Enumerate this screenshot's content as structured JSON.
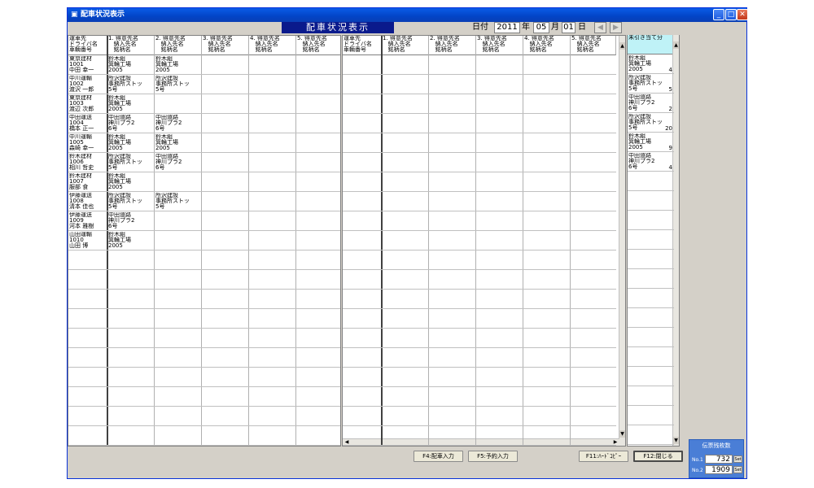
{
  "window": {
    "title": "配車状況表示",
    "title_icon": "app-icon",
    "buttons": [
      "minimize-icon",
      "maximize-icon",
      "close-icon"
    ]
  },
  "header": {
    "title": "配車状況表示",
    "date_label": "日付",
    "year": "2011",
    "year_unit": "年",
    "month": "05",
    "month_unit": "月",
    "day": "01",
    "day_unit": "日",
    "prev_glyph": "◀",
    "next_glyph": "▶"
  },
  "columns": [
    "運車先\nドライバ名\n車輌番号",
    "1. 得意先名\n   納入先名\n   銘柄名",
    "2. 得意先名\n   納入先名\n   銘柄名",
    "3. 得意先名\n   納入先名\n   銘柄名",
    "4. 得意先名\n   納入先名\n   銘柄名",
    "5. 得意先名\n   納入先名\n   銘柄名"
  ],
  "rows": [
    {
      "vehicle": "東京建材\n1001\n中田 幸一",
      "slots": [
        "鈴木組\n箕輪工場\n2005",
        "鈴木組\n箕輪工場\n2005"
      ]
    },
    {
      "vehicle": "中川運輸\n1002\n渡沢 一郎",
      "slots": [
        "所沢建設\n事務所ストッ\n5号",
        "所沢建設\n事務所ストッ\n5号"
      ]
    },
    {
      "vehicle": "東京建材\n1003\n渡辺 次郎",
      "slots": [
        "鈴木組\n箕輪工場\n2005"
      ]
    },
    {
      "vehicle": "中田運送\n1004\n橋本 正一",
      "slots": [
        "中田道路\n神川プラ2\n6号",
        "中田道路\n神川プラ2\n6号"
      ]
    },
    {
      "vehicle": "中川運輸\n1005\n森崎 幸一",
      "slots": [
        "鈴木組\n箕輪工場\n2005",
        "鈴木組\n箕輪工場\n2005"
      ]
    },
    {
      "vehicle": "鈴木建材\n1006\n相川 哲史",
      "slots": [
        "所沢建設\n事務所ストッ\n5号",
        "中田道路\n神川プラ2\n6号"
      ]
    },
    {
      "vehicle": "鈴木建材\n1007\n服部 食",
      "slots": [
        "鈴木組\n箕輪工場\n2005"
      ]
    },
    {
      "vehicle": "伊藤運送\n1008\n清本 佳也",
      "slots": [
        "所沢建設\n事務所ストッ\n5号",
        "所沢建設\n事務所ストッ\n5号"
      ]
    },
    {
      "vehicle": "伊藤運送\n1009\n河本 雅樹",
      "slots": [
        "中田道路\n神川プラ2\n6号"
      ]
    },
    {
      "vehicle": "山田運輸\n1010\n山田 博",
      "slots": [
        "鈴木組\n箕輪工場\n2005"
      ]
    }
  ],
  "unassigned": {
    "header": "未引き当て分",
    "items": [
      {
        "text": "鈴木組\n箕輪工場\n2005",
        "count": "4"
      },
      {
        "text": "所沢建設\n事務所ストッ\n5号",
        "count": "5"
      },
      {
        "text": "中田道路\n神川プラ2\n6号",
        "count": "2"
      },
      {
        "text": "所沢建設\n事務所ストッ\n5号",
        "count": "20"
      },
      {
        "text": "鈴木組\n箕輪工場\n2005",
        "count": "9"
      },
      {
        "text": "中田道路\n神川プラ2\n6号",
        "count": "4"
      }
    ]
  },
  "footer": {
    "f4": "F4:配車入力",
    "f5": "F5:予約入力",
    "f11": "F11:ﾊｰﾄﾞｺﾋﾟｰ",
    "f12": "F12:閉じる"
  },
  "slip": {
    "title": "伝票残枚数",
    "no1_label": "No.1",
    "no1_value": "732",
    "no2_label": "No.2",
    "no2_value": "1909",
    "set_label": "Set"
  },
  "colors": {
    "titlebar": "#0244c6",
    "header_title_bg": "#0a1a8c",
    "unassigned_header_bg": "#bff2f7",
    "window_bg": "#d4d0c8"
  }
}
